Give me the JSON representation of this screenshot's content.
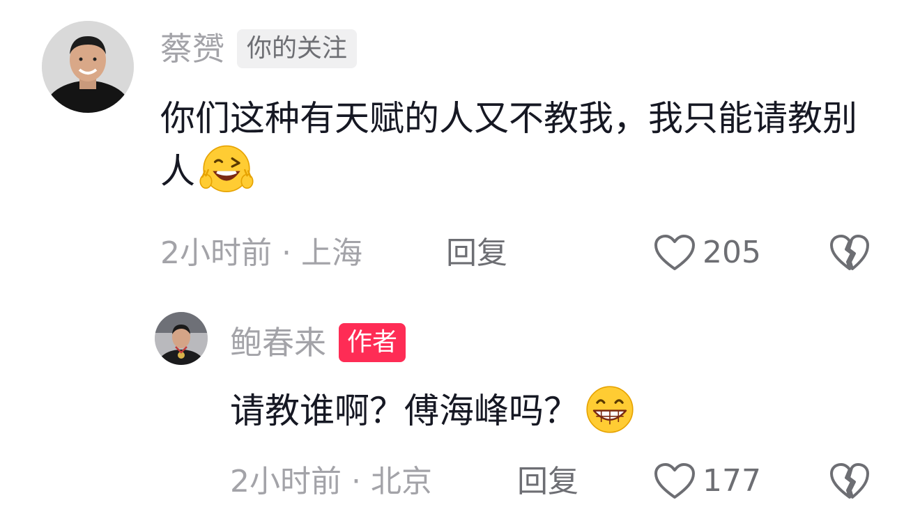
{
  "comments": [
    {
      "username": "蔡赟",
      "badge": "你的关注",
      "avatar": "avatar-man-smiling",
      "text": "你们这种有天赋的人又不教我，我只能请教别人",
      "emoji": "wink-laugh-emoji",
      "time": "2小时前",
      "separator": "·",
      "location": "上海",
      "reply_label": "回复",
      "likes": "205"
    },
    {
      "username": "鲍春来",
      "badge": "作者",
      "avatar": "avatar-athlete-medal",
      "text": "请教谁啊？傅海峰吗？",
      "emoji": "grin-emoji",
      "time": "2小时前",
      "separator": "·",
      "location": "北京",
      "reply_label": "回复",
      "likes": "177"
    }
  ],
  "colors": {
    "author_badge": "#fe2c55",
    "meta_text": "#a3a3a8",
    "body_text": "#161823"
  }
}
